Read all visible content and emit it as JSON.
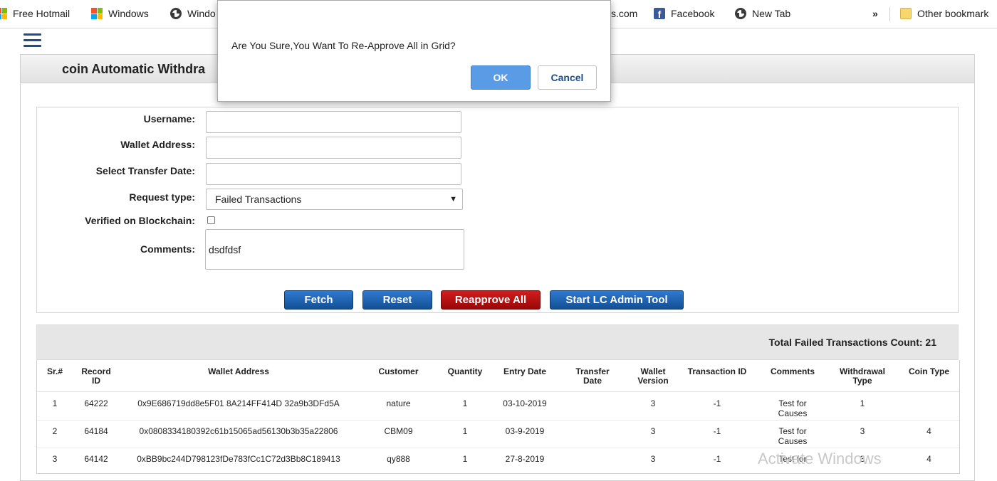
{
  "bookmarks": {
    "items": [
      {
        "label": "Free Hotmail",
        "icon": "windows-flag-icon"
      },
      {
        "label": "Windows",
        "icon": "windows-logo-icon"
      },
      {
        "label": "Windo",
        "icon": "globe-icon"
      },
      {
        "label": "s.com",
        "icon": ""
      },
      {
        "label": "Facebook",
        "icon": "facebook-icon"
      },
      {
        "label": "New Tab",
        "icon": "globe-icon"
      }
    ],
    "overflow": "»",
    "other": "Other bookmark"
  },
  "page": {
    "title": "coin Automatic Withdra"
  },
  "form": {
    "username_label": "Username:",
    "wallet_label": "Wallet Address:",
    "date_label": "Select Transfer Date:",
    "request_label": "Request type:",
    "request_value": "Failed Transactions",
    "verified_label": "Verified on Blockchain:",
    "comments_label": "Comments:",
    "comments_value": "dsdfdsf",
    "buttons": {
      "fetch": "Fetch",
      "reset": "Reset",
      "reapprove": "Reapprove All",
      "admin_tool": "Start LC Admin Tool"
    }
  },
  "summary": {
    "text": "Total Failed Transactions Count: 21"
  },
  "table": {
    "headers": [
      "Sr.#",
      "Record\nID",
      "Wallet Address",
      "Customer",
      "Quantity",
      "Entry Date",
      "Transfer\nDate",
      "Wallet\nVersion",
      "Transaction ID",
      "Comments",
      "Withdrawal\nType",
      "Coin Type"
    ],
    "rows": [
      [
        "1",
        "64222",
        "0x9E686719dd8e5F01 8A214FF414D 32a9b3DFd5A",
        "nature",
        "1",
        "03-10-2019",
        "",
        "3",
        "-1",
        "Test for\nCauses",
        "1",
        ""
      ],
      [
        "2",
        "64184",
        "0x0808334180392c61b15065ad56130b3b35a22806",
        "CBM09",
        "1",
        "03-9-2019",
        "",
        "3",
        "-1",
        "Test for\nCauses",
        "3",
        "4"
      ],
      [
        "3",
        "64142",
        "0xBB9bc244D798123fDe783fCc1C72d3Bb8C189413",
        "qy888",
        "1",
        "27-8-2019",
        "",
        "3",
        "-1",
        "Test for",
        "3",
        "4"
      ]
    ]
  },
  "dialog": {
    "message": "Are You Sure,You Want To Re-Approve All in Grid?",
    "ok": "OK",
    "cancel": "Cancel"
  },
  "watermark": "Activate Windows"
}
